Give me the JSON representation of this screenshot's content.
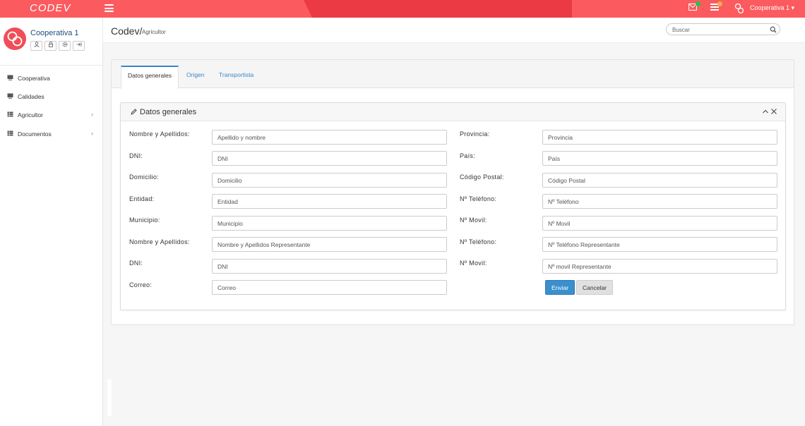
{
  "topbar": {
    "logo": "CODEV",
    "user_label": "Cooperativa 1 ▾",
    "accent": "#fb5b5f",
    "accent_dark": "#ec3a44",
    "icons": [
      "menu-icon",
      "mail-icon",
      "list-icon",
      "brand-logo-icon"
    ]
  },
  "sidebar": {
    "profile_name": "Cooperativa 1",
    "tools": [
      "user-icon",
      "lock-icon",
      "gear-icon",
      "logout-icon"
    ],
    "items": [
      {
        "label": "Cooperativa",
        "icon": "monitor-icon"
      },
      {
        "label": "Calidades",
        "icon": "monitor-icon"
      },
      {
        "label": "Agricultor",
        "icon": "table-icon"
      },
      {
        "label": "Documentos",
        "icon": "table-icon"
      }
    ]
  },
  "header": {
    "crumb_main": "Codev/",
    "crumb_sub": "Agricultor",
    "search_placeholder": "Buscar"
  },
  "tabs": [
    "Datos generales",
    "Origen",
    "Transportista"
  ],
  "form": {
    "title": "Datos generales",
    "left": [
      {
        "label": "Nombre y Apellidos:",
        "placeholder": "Apellido y nombre"
      },
      {
        "label": "DNI:",
        "placeholder": "DNI"
      },
      {
        "label": "Domicilio:",
        "placeholder": "Domicilio"
      },
      {
        "label": "Entidad:",
        "placeholder": "Entidad"
      },
      {
        "label": "Municipio:",
        "placeholder": "Municipio"
      },
      {
        "label": "Nombre y Apellidos:",
        "placeholder": "Nombre y Apellidos Representante"
      },
      {
        "label": "DNI:",
        "placeholder": "DNI"
      },
      {
        "label": "Correo:",
        "placeholder": "Correo"
      }
    ],
    "right": [
      {
        "label": "Provincia:",
        "placeholder": "Provincia"
      },
      {
        "label": "País:",
        "placeholder": "País"
      },
      {
        "label": "Código Postal:",
        "placeholder": "Código Postal"
      },
      {
        "label": "Nº Teléfono:",
        "placeholder": "Nº Teléfono"
      },
      {
        "label": "Nº Movil:",
        "placeholder": "Nº Movil"
      },
      {
        "label": "Nº Teléfono:",
        "placeholder": "Nº Teléfono Representante"
      },
      {
        "label": "Nº Movil:",
        "placeholder": "Nº movil Representante"
      }
    ],
    "submit_label": "Enviar",
    "cancel_label": "Cancelar"
  }
}
